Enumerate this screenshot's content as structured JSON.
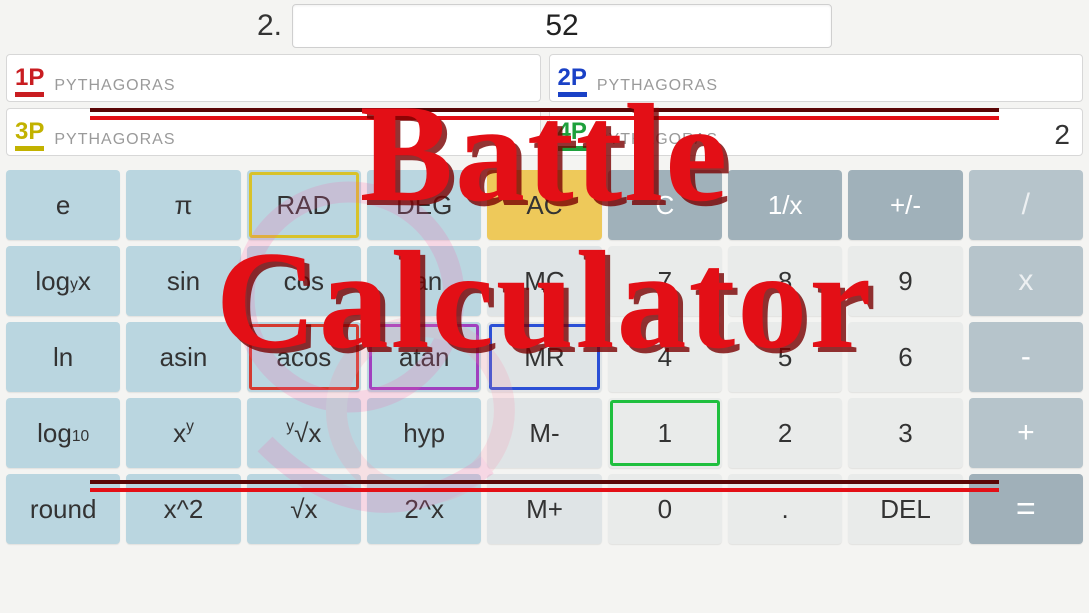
{
  "top": {
    "index_label": "2.",
    "value": "52"
  },
  "players": {
    "p1": {
      "tag": "1P",
      "label": "PYTHAGORAS",
      "score": ""
    },
    "p2": {
      "tag": "2P",
      "label": "PYTHAGORAS",
      "score": ""
    },
    "p3": {
      "tag": "3P",
      "label": "PYTHAGORAS",
      "score": ""
    },
    "p4": {
      "tag": "4P",
      "label": "PYTHAGORAS",
      "score": "2"
    }
  },
  "keys": {
    "e": "e",
    "pi": "π",
    "rad": "RAD",
    "deg": "DEG",
    "ac": "AC",
    "c": "C",
    "inv": "1/x",
    "sign": "+/-",
    "div": "/",
    "logyx": "log",
    "logyx_sub": "y",
    "logyx_tail": "x",
    "sin": "sin",
    "cos": "cos",
    "tan": "tan",
    "mc": "MC",
    "d7": "7",
    "d8": "8",
    "d9": "9",
    "mul": "x",
    "ln": "ln",
    "asin": "asin",
    "acos": "acos",
    "atan": "atan",
    "mr": "MR",
    "d4": "4",
    "d5": "5",
    "d6": "6",
    "sub": "-",
    "log10": "log",
    "log10_sub": "10",
    "xy": "x",
    "xy_sup": "y",
    "yroot_pre": "y",
    "yroot": "√x",
    "hyp": "hyp",
    "mminus": "M-",
    "d1": "1",
    "d2": "2",
    "d3": "3",
    "add": "+",
    "round": "round",
    "x2": "x^2",
    "sqrt": "√x",
    "exp2": "2^x",
    "mplus": "M+",
    "d0": "0",
    "dot": ".",
    "del": "DEL",
    "eq": "="
  },
  "title": {
    "line1": "Battle",
    "line2": "Calculator"
  }
}
